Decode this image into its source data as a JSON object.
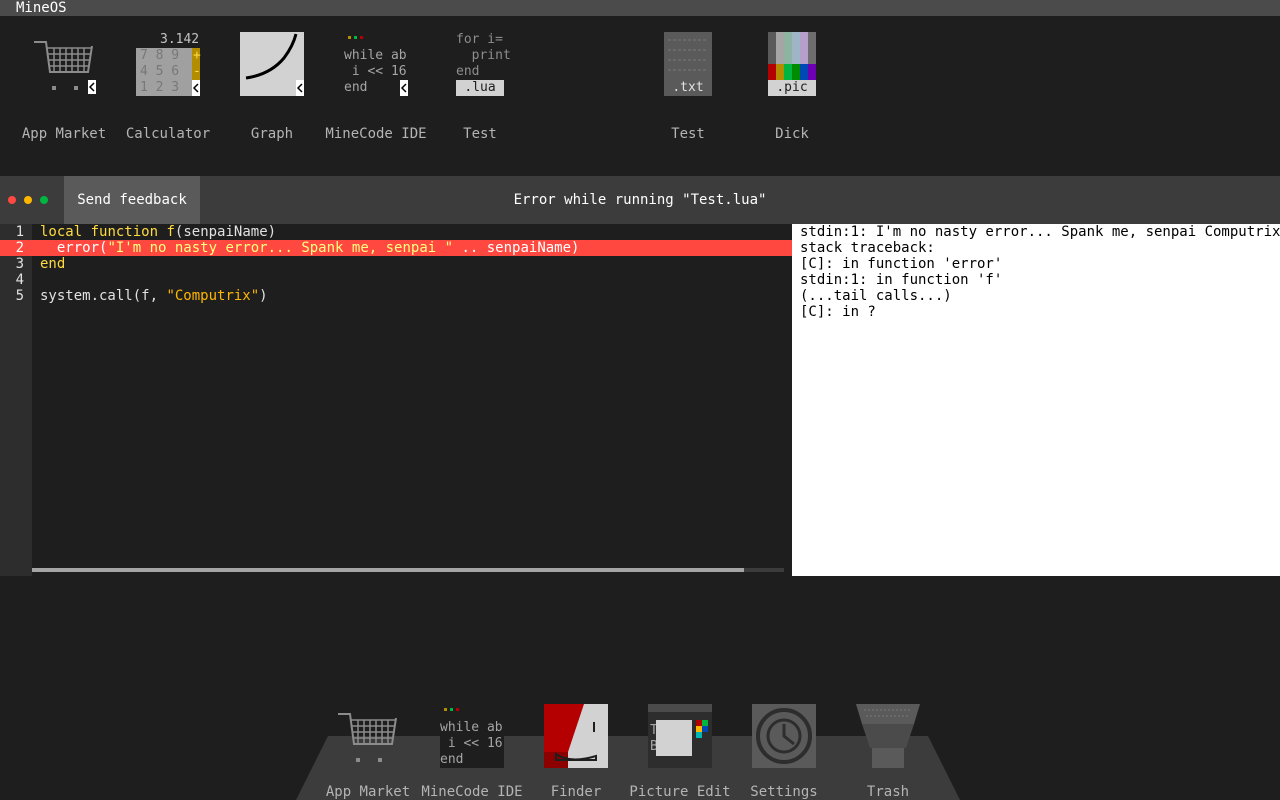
{
  "topbar": {
    "brand": "MineOS"
  },
  "desktop": {
    "icons": [
      {
        "label": "App Market",
        "icon": "shopping-cart-icon"
      },
      {
        "label": "Calculator",
        "icon": "calculator-icon",
        "display": "3.142",
        "keys": [
          "7 8 9",
          "4 5 6",
          "1 2 3"
        ],
        "ops": [
          "+",
          "-"
        ]
      },
      {
        "label": "Graph",
        "icon": "graph-icon"
      },
      {
        "label": "MineCode IDE",
        "icon": "code-editor-icon",
        "lines": [
          "while ab",
          " i << 16",
          "end"
        ]
      },
      {
        "label": "Test",
        "icon": "lua-file-icon",
        "lines": [
          "for i=",
          "  print",
          "end"
        ],
        "ext": ".lua"
      },
      {
        "label": "Test",
        "icon": "text-file-icon",
        "ext": ".txt"
      },
      {
        "label": "Dick",
        "icon": "picture-file-icon",
        "ext": ".pic"
      }
    ]
  },
  "window": {
    "tab": "Send feedback",
    "title": "Error while running \"Test.lua\"",
    "code": {
      "line_numbers": [
        "1",
        "2",
        "3",
        "4",
        "5"
      ],
      "lines": [
        {
          "kw": "local",
          "kw2": "function",
          "fn": "f",
          "rest": "(senpaiName)"
        },
        {
          "fn": "error",
          "open": "(",
          "str": "\"I'm no nasty error... Spank me, senpai \"",
          "rest": " .. senpaiName)"
        },
        {
          "kw": "end"
        },
        {
          "text": ""
        },
        {
          "pre": "system.call(f, ",
          "str": "\"Computrix\"",
          "rest": ")"
        }
      ],
      "error_line": "2"
    },
    "console": [
      "stdin:1: I'm no nasty error... Spank me, senpai Computrix",
      "stack traceback:",
      "[C]: in function 'error'",
      "stdin:1: in function 'f'",
      "(...tail calls...)",
      "[C]: in ?"
    ]
  },
  "dock": {
    "items": [
      {
        "label": "App Market",
        "icon": "shopping-cart-icon"
      },
      {
        "label": "MineCode IDE",
        "icon": "code-editor-icon",
        "lines": [
          "while ab",
          " i << 16",
          "end"
        ]
      },
      {
        "label": "Finder",
        "icon": "finder-icon"
      },
      {
        "label": "Picture Edit",
        "icon": "picture-edit-icon"
      },
      {
        "label": "Settings",
        "icon": "settings-icon"
      },
      {
        "label": "Trash",
        "icon": "trash-icon"
      }
    ]
  },
  "colors": {
    "error_red": "#ff4940",
    "keyword_yellow": "#ffdb40",
    "string_orange": "#ffb600",
    "titlebar": "#3c3c3c"
  }
}
